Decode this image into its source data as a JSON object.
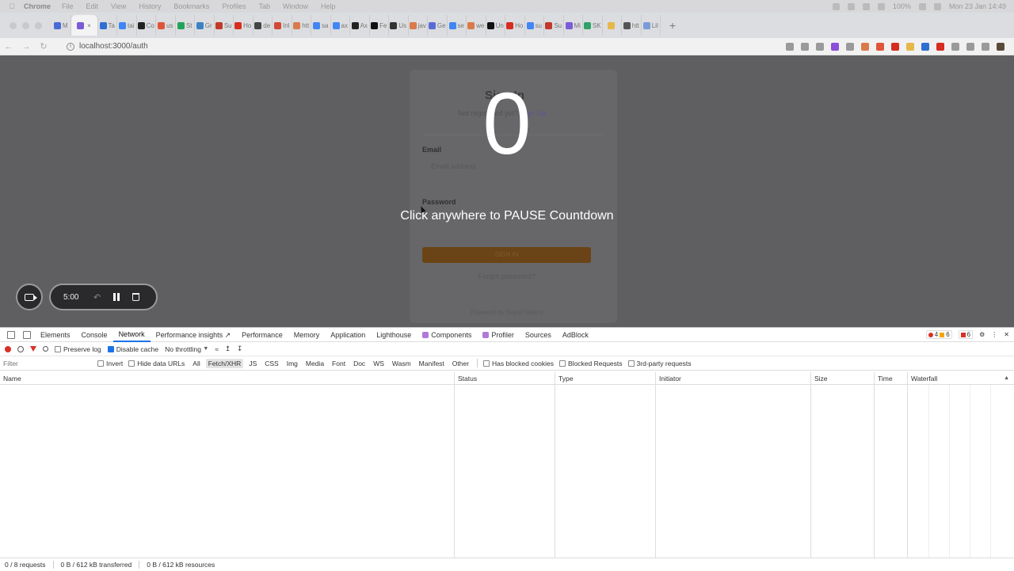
{
  "menubar": {
    "app": "Chrome",
    "items": [
      "File",
      "Edit",
      "View",
      "History",
      "Bookmarks",
      "Profiles",
      "Tab",
      "Window",
      "Help"
    ],
    "battery": "100%",
    "datetime": "Mon 23 Jan  14:49"
  },
  "tabs": [
    {
      "label": "M",
      "color": "#4a6bd6"
    },
    {
      "label": "",
      "color": "#7b5bd6",
      "active": true
    },
    {
      "label": "Ta",
      "color": "#2f6fd1"
    },
    {
      "label": "tai",
      "color": "#4285f4"
    },
    {
      "label": "Co",
      "color": "#222222"
    },
    {
      "label": "us",
      "color": "#e0553a"
    },
    {
      "label": "St",
      "color": "#21a35a"
    },
    {
      "label": "Gr",
      "color": "#3b82c4"
    },
    {
      "label": "Su",
      "color": "#c0392b"
    },
    {
      "label": "Ho",
      "color": "#d62d20"
    },
    {
      "label": "de",
      "color": "#444444"
    },
    {
      "label": "Inl",
      "color": "#d14836"
    },
    {
      "label": "htt",
      "color": "#d97a4a"
    },
    {
      "label": "sa",
      "color": "#4285f4"
    },
    {
      "label": "ax",
      "color": "#4285f4"
    },
    {
      "label": "Ax",
      "color": "#222222"
    },
    {
      "label": "Fe",
      "color": "#111111"
    },
    {
      "label": "Us",
      "color": "#333333"
    },
    {
      "label": "jav",
      "color": "#d97a4a"
    },
    {
      "label": "Ge",
      "color": "#5b6bd6"
    },
    {
      "label": "se",
      "color": "#4285f4"
    },
    {
      "label": "we",
      "color": "#d97a4a"
    },
    {
      "label": "Un",
      "color": "#111111"
    },
    {
      "label": "Ho",
      "color": "#d62d20"
    },
    {
      "label": "su",
      "color": "#4285f4"
    },
    {
      "label": "Su",
      "color": "#c0392b"
    },
    {
      "label": "Mi",
      "color": "#7b5bd6"
    },
    {
      "label": "SK",
      "color": "#2fa36a"
    },
    {
      "label": "",
      "color": "#e6b84a"
    },
    {
      "label": "htt",
      "color": "#555555"
    },
    {
      "label": "Lil",
      "color": "#7b9bd6"
    }
  ],
  "address": {
    "url": "localhost:3000/auth"
  },
  "toolbar_icon_colors": [
    "#9a9a9a",
    "#9a9a9a",
    "#9a9a9a",
    "#8a4fd6",
    "#9a9a9a",
    "#d97a4a",
    "#e0553a",
    "#d62d20",
    "#e6b84a",
    "#2f6fd1",
    "#d62d20",
    "#9a9a9a",
    "#9a9a9a",
    "#9a9a9a",
    "#5a4a3a"
  ],
  "auth": {
    "title": "Sign In",
    "sub_prefix": "Not registered yet?",
    "sub_link": "Sign Up",
    "email_label": "Email",
    "email_placeholder": "Email address",
    "password_label": "Password",
    "signin": "SIGN IN",
    "forgot": "Forgot password?",
    "footer": "Powered by SuperTokens"
  },
  "overlay": {
    "countdown": "0",
    "hint": "Click anywhere to PAUSE Countdown"
  },
  "recorder": {
    "time": "5:00"
  },
  "devtools": {
    "tabs": [
      {
        "label": "Elements"
      },
      {
        "label": "Console"
      },
      {
        "label": "Network",
        "active": true
      },
      {
        "label": "Performance insights ↗"
      },
      {
        "label": "Performance"
      },
      {
        "label": "Memory"
      },
      {
        "label": "Application"
      },
      {
        "label": "Lighthouse"
      },
      {
        "label": "Components",
        "badge": true
      },
      {
        "label": "Profiler",
        "badge": true
      },
      {
        "label": "Sources"
      },
      {
        "label": "AdBlock"
      }
    ],
    "errors": "4",
    "warnings": "6",
    "issues": "6",
    "toolbar": {
      "preserve_log": "Preserve log",
      "disable_cache": "Disable cache",
      "throttling": "No throttling"
    },
    "filter": {
      "placeholder": "Filter",
      "invert": "Invert",
      "hide_data_urls": "Hide data URLs",
      "types": [
        {
          "label": "All"
        },
        {
          "label": "Fetch/XHR",
          "active": true
        },
        {
          "label": "JS"
        },
        {
          "label": "CSS"
        },
        {
          "label": "Img"
        },
        {
          "label": "Media"
        },
        {
          "label": "Font"
        },
        {
          "label": "Doc"
        },
        {
          "label": "WS"
        },
        {
          "label": "Wasm"
        },
        {
          "label": "Manifest"
        },
        {
          "label": "Other"
        }
      ],
      "blocked_cookies": "Has blocked cookies",
      "blocked_requests": "Blocked Requests",
      "third_party": "3rd-party requests"
    },
    "columns": [
      "Name",
      "Status",
      "Type",
      "Initiator",
      "Size",
      "Time",
      "Waterfall"
    ],
    "status": {
      "requests": "0 / 8 requests",
      "transferred": "0 B / 612 kB transferred",
      "resources": "0 B / 612 kB resources"
    }
  }
}
